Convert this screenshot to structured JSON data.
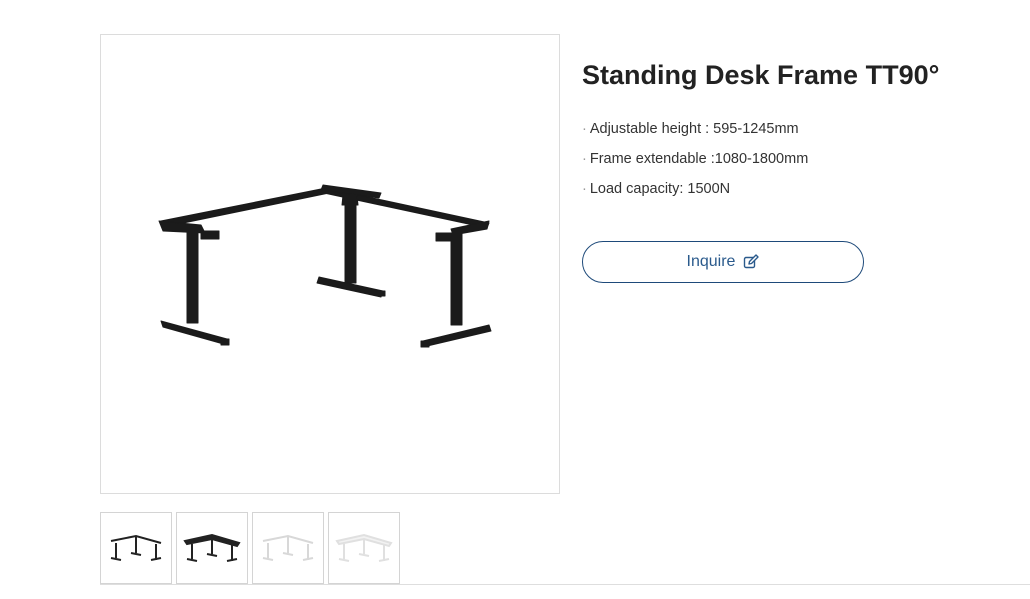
{
  "product": {
    "title": "Standing Desk Frame TT90°",
    "specs": [
      "Adjustable height : 595-1245mm",
      "Frame extendable :1080-1800mm",
      "Load capacity: 1500N"
    ],
    "bullet": "·",
    "inquire_label": "Inquire",
    "inquire_icon": "edit-icon"
  },
  "gallery": {
    "main_image": "l-shaped-desk-frame-black",
    "thumbnails": [
      {
        "name": "frame-black",
        "color": "#222222"
      },
      {
        "name": "frame-black-with-top",
        "color": "#222222"
      },
      {
        "name": "frame-white",
        "color": "#d8d8d8"
      },
      {
        "name": "frame-white-with-top",
        "color": "#e0e0e0"
      }
    ]
  },
  "colors": {
    "accent": "#2a5a8c",
    "frame": "#1a1a1a"
  }
}
